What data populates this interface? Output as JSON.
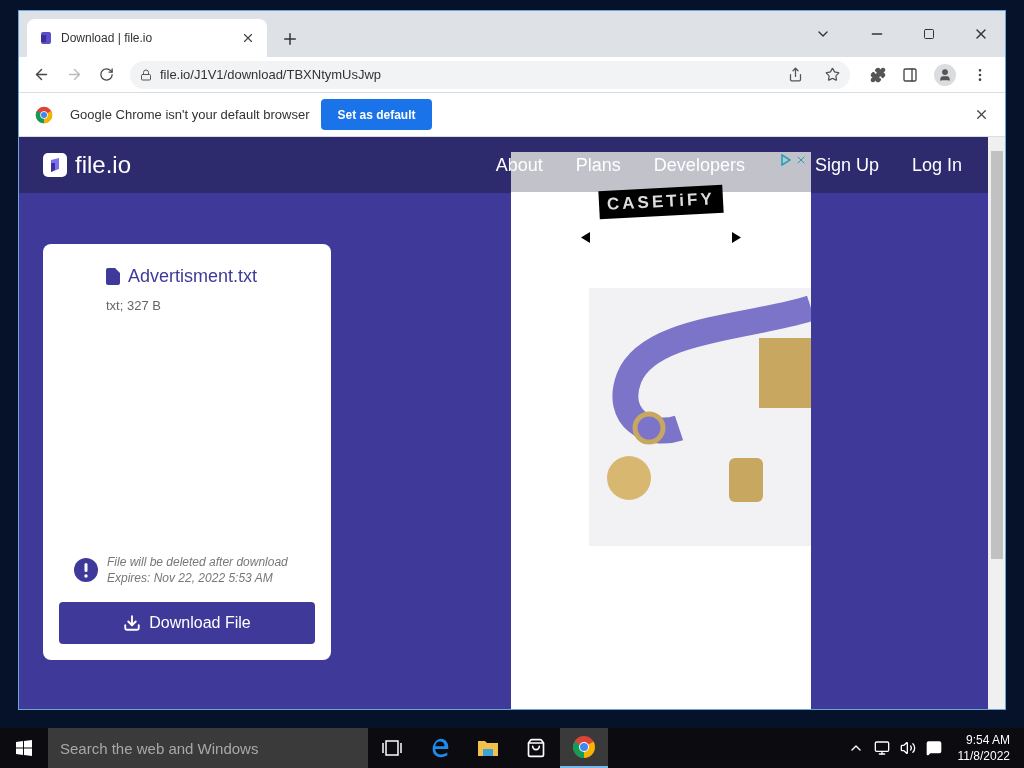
{
  "browser": {
    "tabs": [
      {
        "title": "Download | file.io",
        "selected": true
      }
    ],
    "address": "file.io/J1V1/download/TBXNtymUsJwp",
    "infobar": {
      "message": "Google Chrome isn't your default browser",
      "button": "Set as default"
    }
  },
  "page": {
    "logo": "file.io",
    "nav_links": [
      {
        "label": "About"
      },
      {
        "label": "Plans"
      },
      {
        "label": "Developers"
      }
    ],
    "account_links": [
      {
        "label": "Sign Up"
      },
      {
        "label": "Log In"
      }
    ],
    "file": {
      "name": "Advertisment.txt",
      "meta": "txt; 327 B",
      "notice": [
        "File will be deleted after download",
        "Expires: Nov 22, 2022 5:53 AM"
      ],
      "button": "Download File"
    },
    "ad": {
      "brand": "CASETiFY"
    }
  },
  "taskbar": {
    "search_placeholder": "Search the web and Windows",
    "apps": [
      {
        "kind": "taskview",
        "selected": false
      },
      {
        "kind": "edge",
        "selected": false
      },
      {
        "kind": "folder",
        "selected": false
      },
      {
        "kind": "store",
        "selected": false
      },
      {
        "kind": "chrome",
        "selected": true
      }
    ],
    "time": "9:54 AM",
    "date": "11/8/2022"
  }
}
